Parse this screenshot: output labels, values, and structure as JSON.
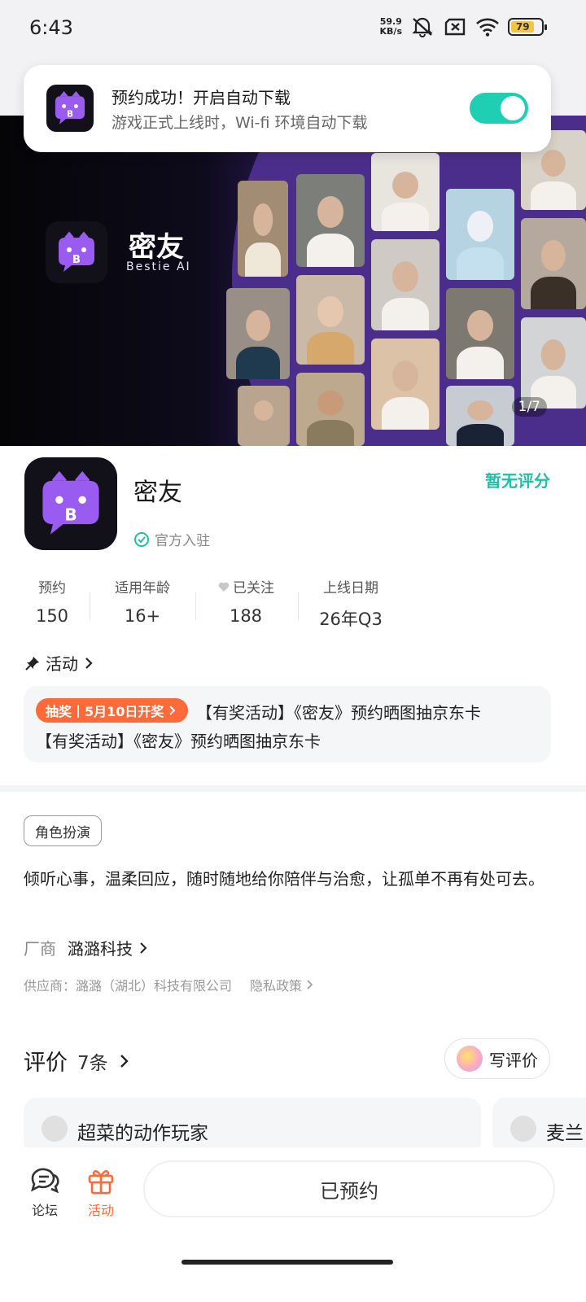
{
  "status_bar": {
    "time": "6:43",
    "net_speed_value": "59.9",
    "net_speed_unit": "KB/s",
    "battery": "79",
    "icons": [
      "mute-icon",
      "sim-off-icon",
      "wifi-icon",
      "battery-icon"
    ]
  },
  "toast": {
    "title": "预约成功！开启自动下载",
    "subtitle": "游戏正式上线时，Wi-fi 环境自动下载",
    "toggle_on": true,
    "accent": "#1fcfb4"
  },
  "banner": {
    "title": "密友",
    "subtitle": "Bestie AI",
    "counter": "1/7"
  },
  "app": {
    "name": "密友",
    "official_label": "官方入驻",
    "rating": "暂无评分",
    "accent": "#1fbfa6"
  },
  "stats": [
    {
      "label": "预约",
      "value": "150"
    },
    {
      "label": "适用年龄",
      "value": "16+"
    },
    {
      "label": "已关注",
      "value": "188"
    },
    {
      "label": "上线日期",
      "value": "26年Q3"
    }
  ],
  "activity": {
    "header": "活动",
    "badge": "抽奖丨5月10日开奖",
    "line1": "【有奖活动】《密友》预约晒图抽京东卡",
    "line2": "【有奖活动】《密友》预约晒图抽京东卡",
    "badge_color": "#ff6a3a"
  },
  "details": {
    "tag": "角色扮演",
    "description": "倾听心事，温柔回应，随时随地给你陪伴与治愈，让孤单不再有处可去。",
    "vendor_label": "厂商",
    "vendor_name": "潞潞科技",
    "supplier": "供应商：潞潞（湖北）科技有限公司",
    "privacy": "隐私政策"
  },
  "reviews": {
    "title": "评价",
    "count": "7条",
    "write_label": "写评价",
    "items": [
      {
        "name": "超菜的动作玩家"
      },
      {
        "name": "麦兰"
      }
    ]
  },
  "bottom_nav": {
    "forum": "论坛",
    "activity": "活动",
    "reserve": "已预约",
    "active_color": "#ff6a3a"
  }
}
